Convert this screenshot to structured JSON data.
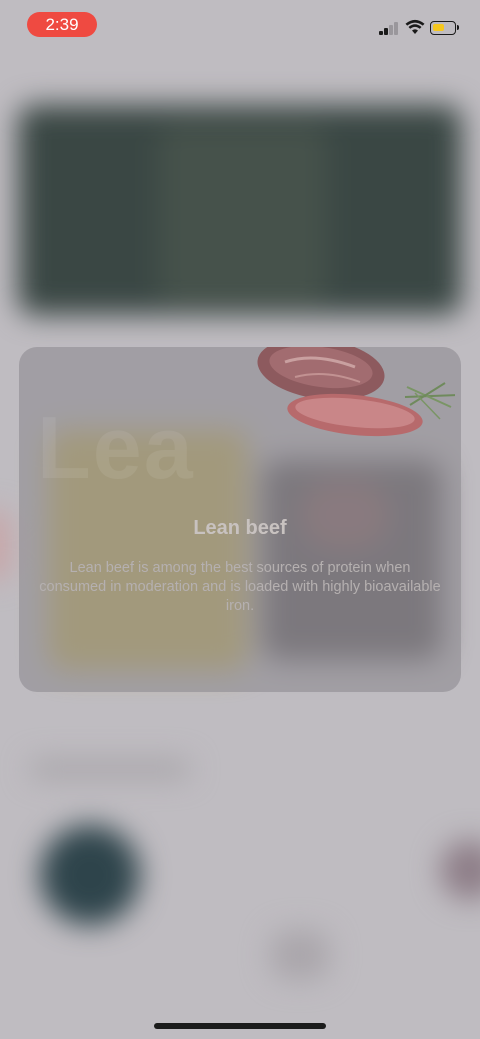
{
  "status_bar": {
    "time": "2:39",
    "time_pill_color": "#ef4a41",
    "battery_color": "#f6c81f",
    "icons": [
      "signal-icon",
      "wifi-icon",
      "battery-icon"
    ]
  },
  "card": {
    "watermark": "Lea",
    "image_name": "lean-beef-slices",
    "title": "Lean beef",
    "description": "Lean beef is among the best sources of protein when consumed in moderation and is loaded with highly bioavailable iron."
  }
}
